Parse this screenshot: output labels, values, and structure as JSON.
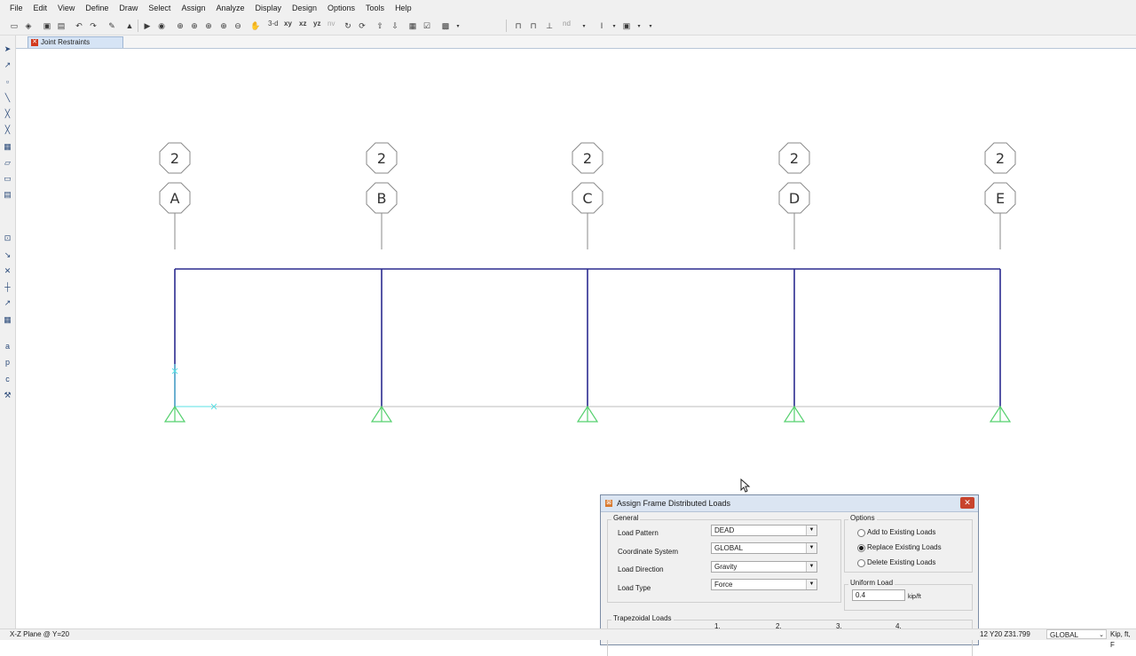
{
  "menu": [
    "File",
    "Edit",
    "View",
    "Define",
    "Draw",
    "Select",
    "Assign",
    "Analyze",
    "Display",
    "Design",
    "Options",
    "Tools",
    "Help"
  ],
  "toolbar": {
    "view_3d": "3-d",
    "view_xy": "xy",
    "view_xz": "xz",
    "view_yz": "yz",
    "view_nv": "nv",
    "nd": "nd"
  },
  "tab": {
    "label": "Joint Restraints"
  },
  "grid": {
    "top_bubble": "2",
    "columns": [
      "A",
      "B",
      "C",
      "D",
      "E"
    ]
  },
  "colors": {
    "frame": "#2b2b8f",
    "support": "#55d06e",
    "grid_line": "#8a8a8a",
    "axis": "#59e0e6"
  },
  "status": {
    "plane": "X-Z Plane @ Y=20",
    "coords": "12  Y20  Z31.799",
    "coord_system": "GLOBAL",
    "units": "Kip, ft, F"
  },
  "dialog": {
    "title": "Assign Frame Distributed Loads",
    "general_caption": "General",
    "fields": [
      {
        "label": "Load Pattern",
        "value": "DEAD"
      },
      {
        "label": "Coordinate System",
        "value": "GLOBAL"
      },
      {
        "label": "Load Direction",
        "value": "Gravity"
      },
      {
        "label": "Load Type",
        "value": "Force"
      }
    ],
    "options_caption": "Options",
    "options": [
      {
        "label": "Add to Existing Loads",
        "selected": false
      },
      {
        "label": "Replace Existing Loads",
        "selected": true
      },
      {
        "label": "Delete Existing Loads",
        "selected": false
      }
    ],
    "uniform_caption": "Uniform Load",
    "uniform_value": "0.4",
    "uniform_units": "kip/ft",
    "trap_caption": "Trapezoidal Loads",
    "trap_columns": [
      "1.",
      "2.",
      "3.",
      "4."
    ]
  }
}
